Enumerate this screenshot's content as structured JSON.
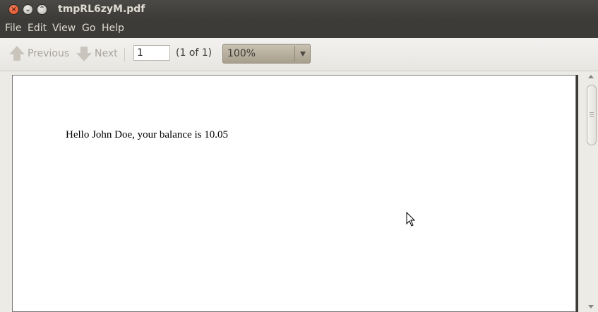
{
  "window": {
    "title": "tmpRL6zyM.pdf"
  },
  "window_controls": {
    "close": "×",
    "minimize": "⌄",
    "maximize": "⌃"
  },
  "menu": [
    "File",
    "Edit",
    "View",
    "Go",
    "Help"
  ],
  "toolbar": {
    "previous_label": "Previous",
    "next_label": "Next",
    "page_input_value": "1",
    "page_count": "(1 of 1)",
    "zoom_value": "100%"
  },
  "document": {
    "text": "Hello John Doe, your balance is 10.05"
  },
  "colors": {
    "titlebar": "#3c3b37",
    "close_button": "#df4a16",
    "toolbar": "#f2f1ef"
  }
}
